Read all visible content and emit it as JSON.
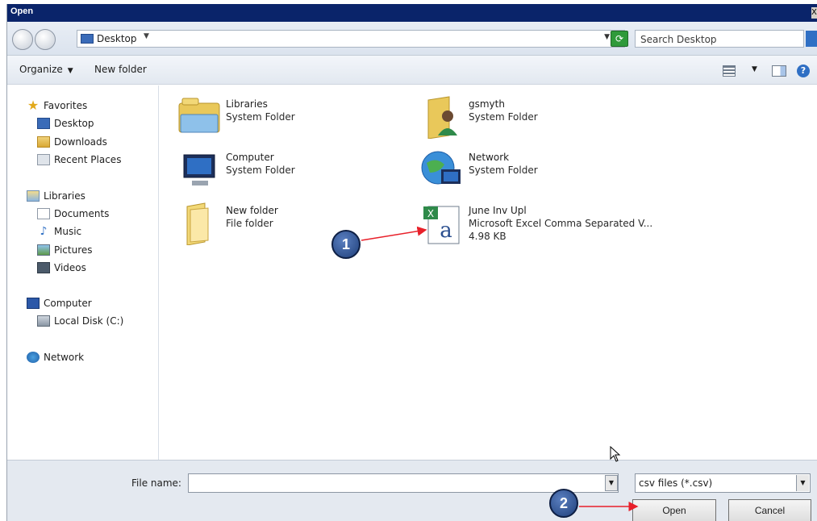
{
  "window": {
    "title": "Open"
  },
  "address": {
    "location": "Desktop",
    "search_placeholder": "Search Desktop"
  },
  "toolbar": {
    "organize": "Organize",
    "new_folder": "New folder"
  },
  "sidebar": {
    "groups": [
      {
        "label": "Favorites",
        "items": [
          "Desktop",
          "Downloads",
          "Recent Places"
        ]
      },
      {
        "label": "Libraries",
        "items": [
          "Documents",
          "Music",
          "Pictures",
          "Videos"
        ]
      },
      {
        "label": "Computer",
        "items": [
          "Local Disk (C:)"
        ]
      },
      {
        "label": "Network",
        "items": []
      }
    ]
  },
  "files": [
    {
      "name": "Libraries",
      "type": "System Folder",
      "icon": "libraries-icon"
    },
    {
      "name": "gsmyth",
      "type": "System Folder",
      "icon": "user-folder-icon"
    },
    {
      "name": "Computer",
      "type": "System Folder",
      "icon": "computer-icon"
    },
    {
      "name": "Network",
      "type": "System Folder",
      "icon": "network-icon"
    },
    {
      "name": "New folder",
      "type": "File folder",
      "icon": "folder-icon"
    },
    {
      "name": "June Inv Upl",
      "type": "Microsoft Excel Comma Separated V...",
      "size": "4.98 KB",
      "icon": "excel-csv-icon"
    }
  ],
  "footer": {
    "file_name_label": "File name:",
    "file_name_value": "",
    "filter": "csv files (*.csv)",
    "open_label": "Open",
    "cancel_label": "Cancel"
  },
  "annotations": [
    "1",
    "2"
  ],
  "colors": {
    "titlebar": "#0a246a",
    "arrow": "#e8202a",
    "callout": "#2a4f94"
  }
}
